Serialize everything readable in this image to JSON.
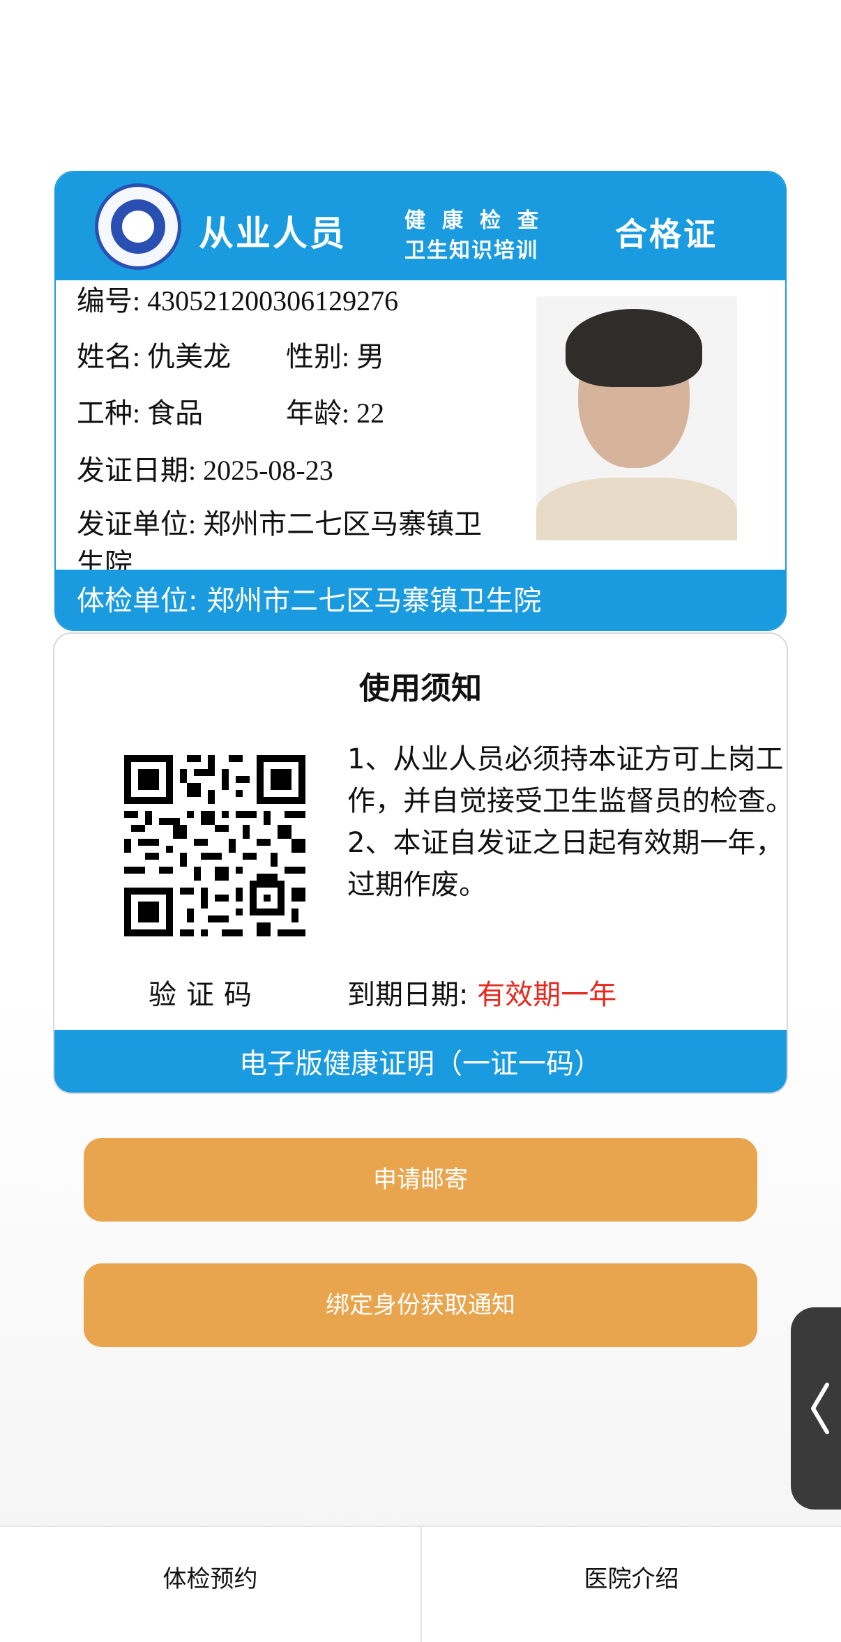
{
  "certificate": {
    "header": {
      "title": "从业人员",
      "subtitle_line1": "健康检查",
      "subtitle_line2": "卫生知识培训",
      "title_tail": "合格证"
    },
    "fields": {
      "number": "编号: 430521200306129276",
      "name": "姓名: 仇美龙",
      "gender": "性别: 男",
      "job_type": "工种: 食品",
      "age": "年龄: 22",
      "issue_date": "发证日期: 2025-08-23",
      "issuer": "发证单位: 郑州市二七区马寨镇卫生院"
    },
    "exam_unit": "体检单位: 郑州市二七区马寨镇卫生院",
    "colors": {
      "primary_blue": "#1a9be0",
      "emblem_blue": "#2a4fb3"
    }
  },
  "notice": {
    "title": "使用须知",
    "rules_text": "1、从业人员必须持本证方可上岗工作，并自觉接受卫生监督员的检查。\n2、本证自发证之日起有效期一年，过期作废。",
    "qr_caption": "验证码",
    "expiry_label": "到期日期:",
    "expiry_value": "有效期一年",
    "footer": "电子版健康证明（一证一码）",
    "colors": {
      "expiry_red": "#e52a20"
    }
  },
  "actions": {
    "mail_button": "申请邮寄",
    "bind_button": "绑定身份获取通知",
    "button_color": "#e8a54e"
  },
  "side_handle_icon": "chevron-left-icon",
  "tabs": [
    {
      "label": "体检预约"
    },
    {
      "label": "医院介绍"
    }
  ]
}
